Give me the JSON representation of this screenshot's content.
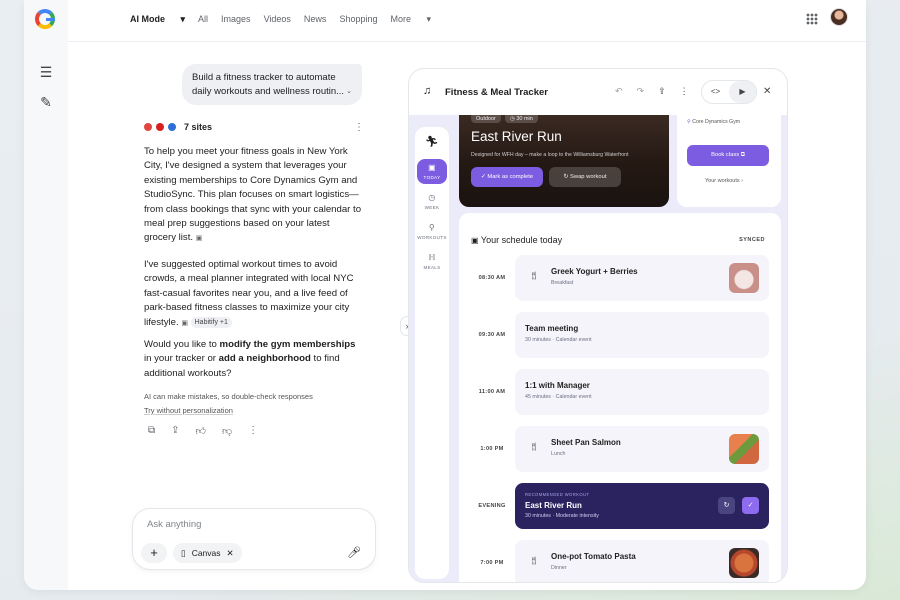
{
  "topbar": {
    "tabs": [
      "AI Mode",
      "All",
      "Images",
      "Videos",
      "News",
      "Shopping",
      "More"
    ],
    "active_tab_suffix": "▾"
  },
  "chat": {
    "prompt_line1": "Build a fitness tracker to automate",
    "prompt_line2": "daily workouts and wellness routin...",
    "sites_label": "7 sites",
    "para1": "To help you meet your fitness goals in New York City, I've designed a system that leverages your existing memberships to Core Dynamics Gym and StudioSync. This plan focuses on smart logistics—from class bookings that sync with your calendar to meal prep suggestions based on your latest grocery list.",
    "para2": "I've suggested optimal workout times to avoid crowds, a meal planner integrated with local NYC fast-casual favorites near you, and a live feed of park-based fitness classes to maximize your city lifestyle.",
    "habitify_chip": "Habitify +1",
    "para3_a": "Would you like to ",
    "para3_b": "modify the gym memberships",
    "para3_c": " in your tracker or ",
    "para3_d": "add a neighborhood",
    "para3_e": " to find additional workouts?",
    "disclaimer": "AI can make mistakes, so double-check responses",
    "try_without": "Try without personalization",
    "ask_placeholder": "Ask anything",
    "canvas_chip": "Canvas"
  },
  "canvas": {
    "title": "Fitness & Meal Tracker",
    "nav": [
      {
        "label": "TODAY",
        "icon": "calendar-icon"
      },
      {
        "label": "WEEK",
        "icon": "clock-icon"
      },
      {
        "label": "WORKOUTS",
        "icon": "dumbbell-icon"
      },
      {
        "label": "MEALS",
        "icon": "fork-icon"
      }
    ],
    "hero": {
      "tag1": "Outdoor",
      "tag2": "30 min",
      "title": "East River Run",
      "subtitle": "Designed for WFH day – make a loop to the Williamsburg Waterfront",
      "btn_complete": "Mark as complete",
      "btn_swap": "Swap workout"
    },
    "side": {
      "location": "Core Dynamics Gym",
      "book": "Book class",
      "your_workouts": "Your workouts ›"
    },
    "schedule": {
      "heading": "Your schedule today",
      "status": "SYNCED",
      "events": [
        {
          "time": "08:30 AM",
          "title": "Greek Yogurt + Berries",
          "sub": "Breakfast",
          "kind": "meal",
          "thumb_color": "#c9908a"
        },
        {
          "time": "09:30 AM",
          "title": "Team meeting",
          "sub": "30 minutes · Calendar event",
          "kind": "event"
        },
        {
          "time": "11:00 AM",
          "title": "1:1 with Manager",
          "sub": "45 minutes · Calendar event",
          "kind": "event"
        },
        {
          "time": "1:00 PM",
          "title": "Sheet Pan Salmon",
          "sub": "Lunch",
          "kind": "meal",
          "thumb_color": "#d0673f"
        },
        {
          "time": "EVENING",
          "title": "East River Run",
          "sub": "30 minutes · Moderate intensity",
          "kind": "workout",
          "kicker": "RECOMMENDED WORKOUT"
        },
        {
          "time": "7:00 PM",
          "title": "One-pot Tomato Pasta",
          "sub": "Dinner",
          "kind": "meal",
          "thumb_color": "#b5482c"
        }
      ]
    }
  },
  "colors": {
    "accent": "#7c5ce0",
    "app_bg": "#ecebfa",
    "workout_card": "#2a2360"
  }
}
